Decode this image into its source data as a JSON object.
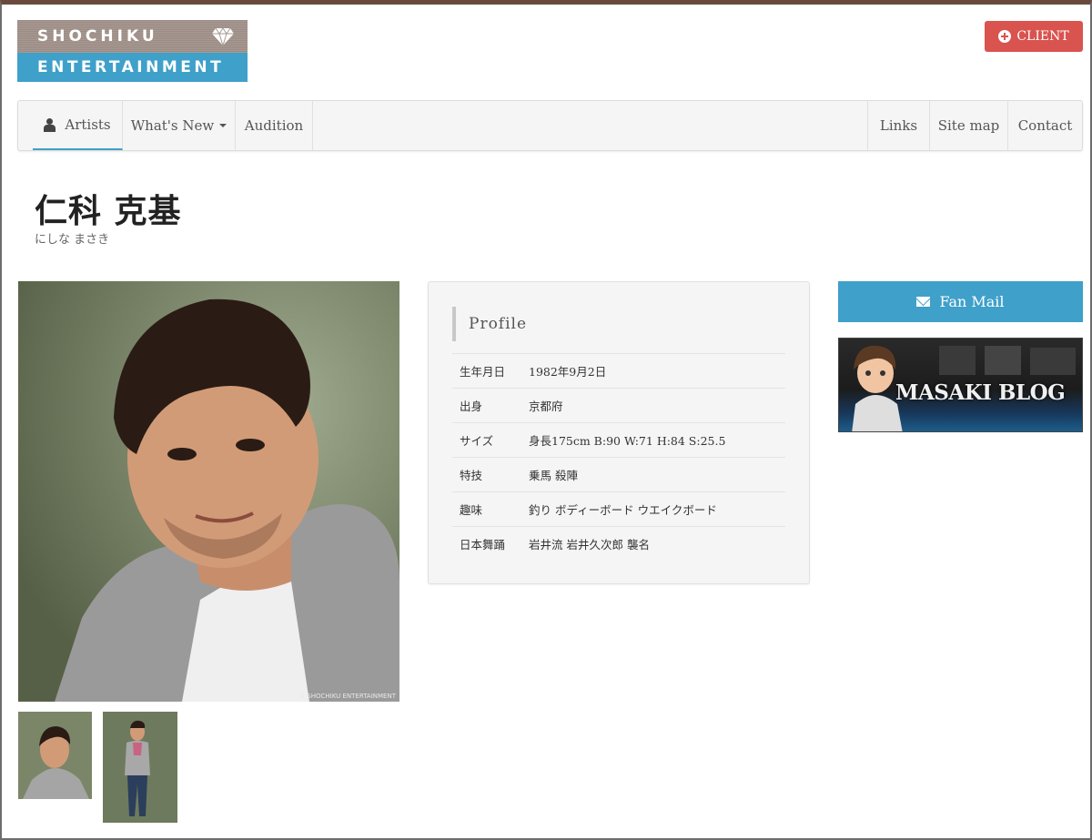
{
  "logo": {
    "top_text": "SHOCHIKU",
    "bottom_text": "ENTERTAINMENT",
    "icon": "diamond-icon",
    "colors": {
      "top": "#a89a92",
      "bottom": "#3fa0c9"
    }
  },
  "header": {
    "client_button": {
      "label": "CLIENT",
      "icon": "plus-circle-icon",
      "color": "#d9534f"
    }
  },
  "nav": {
    "left": [
      {
        "label": "Artists",
        "icon": "person-icon",
        "active": true
      },
      {
        "label": "What's New",
        "icon": "caret-down-icon"
      },
      {
        "label": "Audition"
      }
    ],
    "right": [
      {
        "label": "Links"
      },
      {
        "label": "Site map"
      },
      {
        "label": "Contact"
      }
    ]
  },
  "artist": {
    "name": "仁科 克基",
    "kana": "にしな まさき"
  },
  "profile": {
    "heading": "Profile",
    "rows": [
      {
        "key": "生年月日",
        "value": "1982年9月2日"
      },
      {
        "key": "出身",
        "value": "京都府"
      },
      {
        "key": "サイズ",
        "value": "身長175cm  B:90  W:71  H:84  S:25.5"
      },
      {
        "key": "特技",
        "value": "乗馬  殺陣"
      },
      {
        "key": "趣味",
        "value": "釣り  ボディーボード  ウエイクボード"
      },
      {
        "key": "日本舞踊",
        "value": "岩井流  岩井久次郎  襲名"
      }
    ]
  },
  "sidebar": {
    "fan_mail": {
      "label": "Fan Mail",
      "icon": "envelope-icon",
      "color": "#3fa0c9"
    },
    "blog_banner": {
      "text": "MASAKI BLOG"
    }
  },
  "photo": {
    "copyright": "© SHOCHIKU ENTERTAINMENT"
  }
}
